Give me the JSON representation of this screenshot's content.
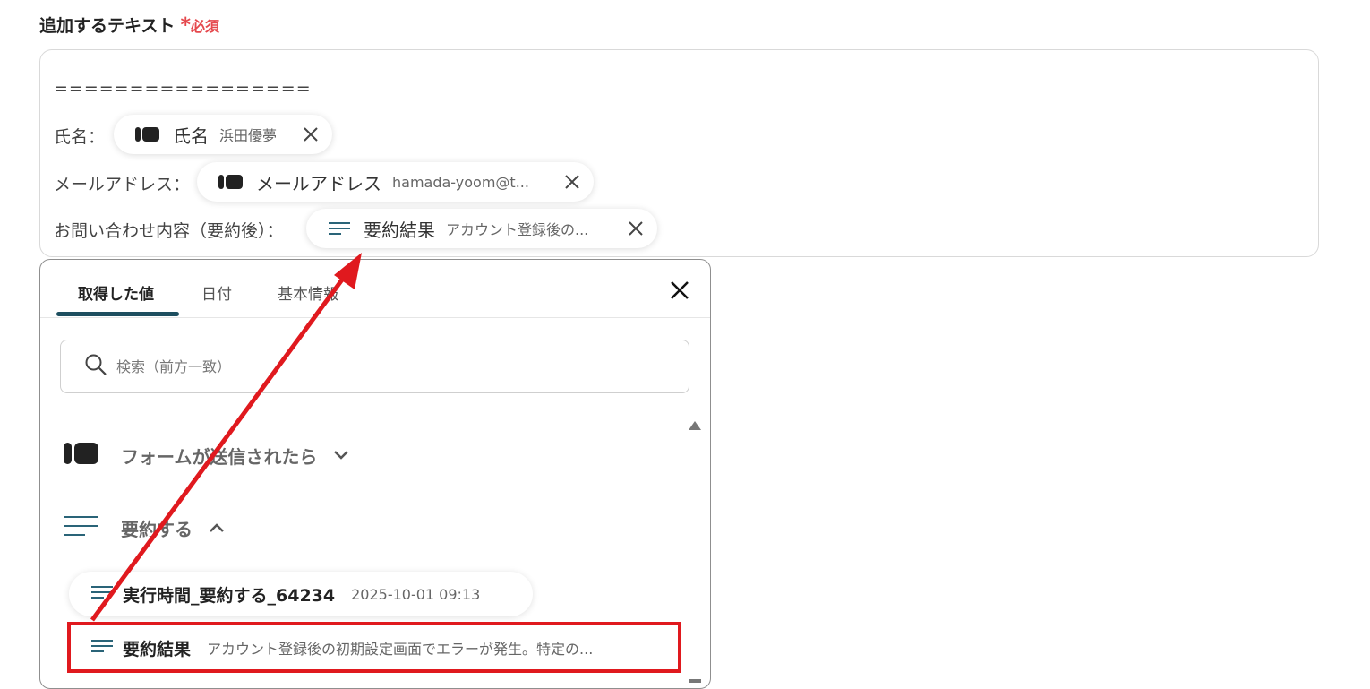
{
  "field": {
    "label": "追加するテキスト",
    "required_star": "*",
    "required_text": "必須"
  },
  "editor": {
    "separator": "=================",
    "rows": [
      {
        "label": "氏名：",
        "chip_name": "氏名",
        "chip_value": "浜田優夢",
        "chip_icon": "form-icon"
      },
      {
        "label": "メールアドレス：",
        "chip_name": "メールアドレス",
        "chip_value": "hamada-yoom@t...",
        "chip_icon": "form-icon"
      },
      {
        "label": "お問い合わせ内容（要約後）：",
        "chip_name": "要約結果",
        "chip_value": "アカウント登録後の...",
        "chip_icon": "summary-lines-icon"
      }
    ]
  },
  "panel": {
    "tabs": [
      {
        "label": "取得した値",
        "active": true
      },
      {
        "label": "日付",
        "active": false
      },
      {
        "label": "基本情報",
        "active": false
      }
    ],
    "search_placeholder": "検索（前方一致）",
    "sections": [
      {
        "label": "フォームが送信されたら",
        "icon": "form-icon",
        "expanded": false
      },
      {
        "label": "要約する",
        "icon": "summary-lines-icon",
        "expanded": true
      }
    ],
    "items": [
      {
        "name": "実行時間_要約する_64234",
        "value": "2025-10-01 09:13"
      },
      {
        "name": "要約結果",
        "value": "アカウント登録後の初期設定画面でエラーが発生。特定の..."
      }
    ]
  },
  "colors": {
    "accent": "#1d4e5f",
    "required": "#e5484d",
    "annotation": "#e0191e"
  }
}
